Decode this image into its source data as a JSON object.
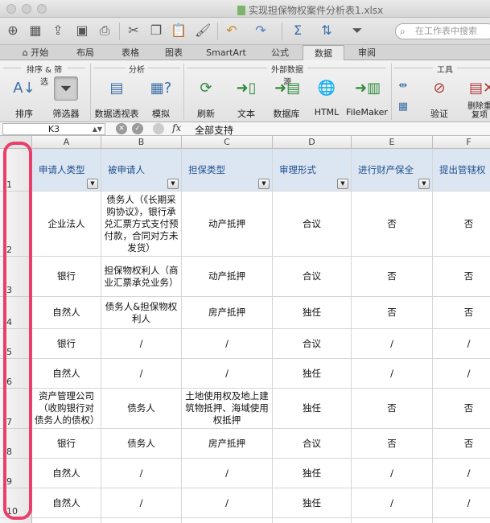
{
  "window": {
    "title": "实现担保物权案件分析表1.xlsx"
  },
  "toolbar": {
    "search_placeholder": "在工作表中搜索",
    "icons": [
      "new-workbook-icon",
      "templates-icon",
      "open-icon",
      "save-icon",
      "print-icon",
      "cut-icon",
      "copy-icon",
      "paste-icon",
      "format-painter-icon",
      "undo-icon",
      "redo-icon",
      "autosum-icon",
      "sort-icon",
      "filter-icon",
      "search-icon"
    ]
  },
  "tabs": [
    "开始",
    "布局",
    "表格",
    "图表",
    "SmartArt",
    "公式",
    "数据",
    "审阅"
  ],
  "active_tab": "数据",
  "ribbon": {
    "groups": [
      {
        "title": "排序 & 筛选",
        "buttons": [
          "排序",
          "筛选器"
        ]
      },
      {
        "title": "分析",
        "buttons": [
          "数据透视表",
          "模拟"
        ]
      },
      {
        "title": "外部数据源",
        "buttons": [
          "刷新",
          "文本",
          "数据库",
          "HTML",
          "FileMaker"
        ]
      },
      {
        "title": "工具",
        "buttons": [
          "验证",
          "删除重复项"
        ]
      }
    ]
  },
  "formula_bar": {
    "cell_ref": "K3",
    "fx": "fx",
    "content": "全部支持"
  },
  "columns": [
    "A",
    "B",
    "C",
    "D",
    "E",
    "F"
  ],
  "header_row": [
    "申请人类型",
    "被申请人",
    "担保类型",
    "审理形式",
    "进行财产保全",
    "提出管辖权"
  ],
  "rows": [
    {
      "num": "1"
    },
    {
      "num": "2",
      "cells": [
        "企业法人",
        "债务人（《长期采购协议》，银行承兑汇票方式支付预付款，合同对方未发货）",
        "动产抵押",
        "合议",
        "否",
        "否"
      ]
    },
    {
      "num": "3",
      "cells": [
        "银行",
        "担保物权利人（商业汇票承兑业务）",
        "动产抵押",
        "合议",
        "否",
        "否"
      ]
    },
    {
      "num": "4",
      "cells": [
        "自然人",
        "债务人&担保物权利人",
        "房产抵押",
        "独任",
        "否",
        "否"
      ]
    },
    {
      "num": "5",
      "cells": [
        "银行",
        "/",
        "/",
        "合议",
        "/",
        "/"
      ]
    },
    {
      "num": "6",
      "cells": [
        "自然人",
        "/",
        "/",
        "独任",
        "/",
        "/"
      ]
    },
    {
      "num": "7",
      "cells": [
        "资产管理公司（收购银行对债务人的债权）",
        "债务人",
        "土地使用权及地上建筑物抵押、海域使用权抵押",
        "独任",
        "否",
        "否"
      ]
    },
    {
      "num": "8",
      "cells": [
        "银行",
        "债务人",
        "房产抵押",
        "合议",
        "否",
        "否"
      ]
    },
    {
      "num": "9",
      "cells": [
        "自然人",
        "/",
        "/",
        "独任",
        "/",
        "/"
      ]
    },
    {
      "num": "10",
      "cells": [
        "自然人",
        "/",
        "/",
        "独任",
        "/",
        "/"
      ]
    }
  ],
  "colors": {
    "header_fill": "#dce6f2",
    "header_text": "#1f4e8c",
    "annotation": "#ea3e6b"
  }
}
